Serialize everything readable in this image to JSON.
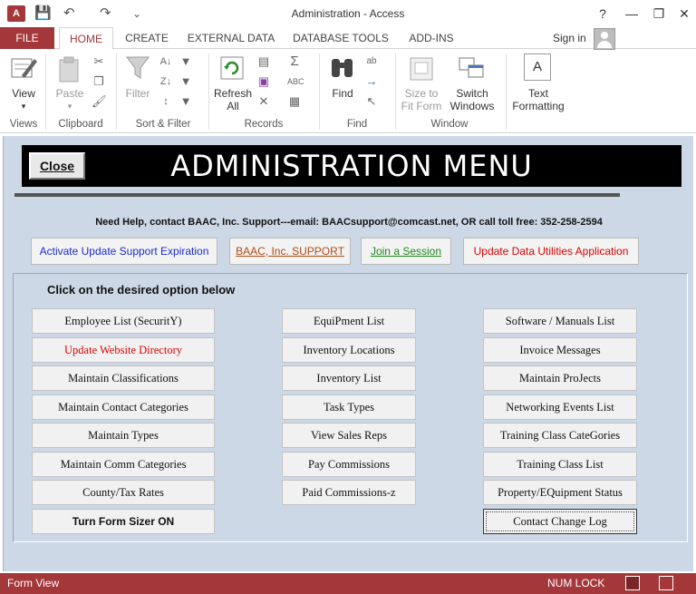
{
  "window": {
    "title": "Administration - Access",
    "app_icon_text": "A",
    "help": "?",
    "min": "—",
    "max": "❐",
    "close": "✕"
  },
  "quick_access": {
    "save": "💾",
    "undo": "↶",
    "redo": "↷",
    "more": "⌄"
  },
  "tabs": {
    "file": "FILE",
    "items": [
      "HOME",
      "CREATE",
      "EXTERNAL DATA",
      "DATABASE TOOLS",
      "ADD-INS"
    ],
    "active": "HOME",
    "signin": "Sign in"
  },
  "ribbon": {
    "groups": [
      "Views",
      "Clipboard",
      "Sort & Filter",
      "Records",
      "Find",
      "Window"
    ],
    "view_label": "View",
    "paste_label": "Paste",
    "filter_label": "Filter",
    "refresh_label": "Refresh",
    "refresh_label2": "All",
    "find_label": "Find",
    "size_label": "Size to",
    "size_label2": "Fit Form",
    "switch_label": "Switch",
    "switch_label2": "Windows",
    "text_label": "Text",
    "text_label2": "Formatting",
    "text_icon": "A"
  },
  "form": {
    "title": "ADMINISTRATION MENU",
    "close_label": "Close",
    "help_text": "Need  Help, contact BAAC, Inc. Support---email: BAACsupport@comcast.net, OR call toll free: 352-258-2594",
    "link_buttons": [
      {
        "label": "Activate Update Support Expiration",
        "color": "#1a2bd6"
      },
      {
        "label": "BAAC, Inc. SUPPORT",
        "color": "#b04a14"
      },
      {
        "label": "Join a Session",
        "color": "#1c8a1c"
      },
      {
        "label": "Update Data Utilities Application",
        "color": "#e00000"
      }
    ],
    "options_heading": "Click on the desired option below",
    "col1": [
      "Employee List (SecuritY)",
      "Update Website Directory",
      "Maintain Classifications",
      "Maintain Contact Categories",
      "Maintain Types",
      "Maintain Comm Categories",
      "County/Tax Rates",
      "Turn Form Sizer ON"
    ],
    "col2": [
      "EquiPment List",
      "Inventory Locations",
      "Inventory List",
      "Task Types",
      "View Sales Reps",
      "Pay Commissions",
      "Paid Commissions-z"
    ],
    "col3": [
      "Software / Manuals List",
      "Invoice Messages",
      "Maintain ProJects",
      "Networking Events List",
      "Training Class CateGories",
      "Training Class List",
      "Property/EQuipment Status",
      "Contact Change Log"
    ]
  },
  "status": {
    "left": "Form View",
    "num_lock": "NUM LOCK"
  }
}
